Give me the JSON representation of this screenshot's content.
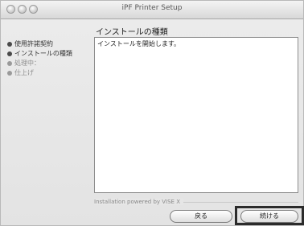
{
  "window": {
    "title": "iPF Printer Setup"
  },
  "heading": "インストールの種類",
  "steps": [
    {
      "label": "使用許諾契約",
      "state": "done"
    },
    {
      "label": "インストールの種類",
      "state": "done"
    },
    {
      "label": "処理中：",
      "state": "pending"
    },
    {
      "label": "仕上げ",
      "state": "pending"
    }
  ],
  "content": {
    "text": "インストールを開始します。"
  },
  "footer": {
    "powered_by": "Installation powered by VISE X"
  },
  "buttons": {
    "back": "戻る",
    "continue": "続ける"
  }
}
